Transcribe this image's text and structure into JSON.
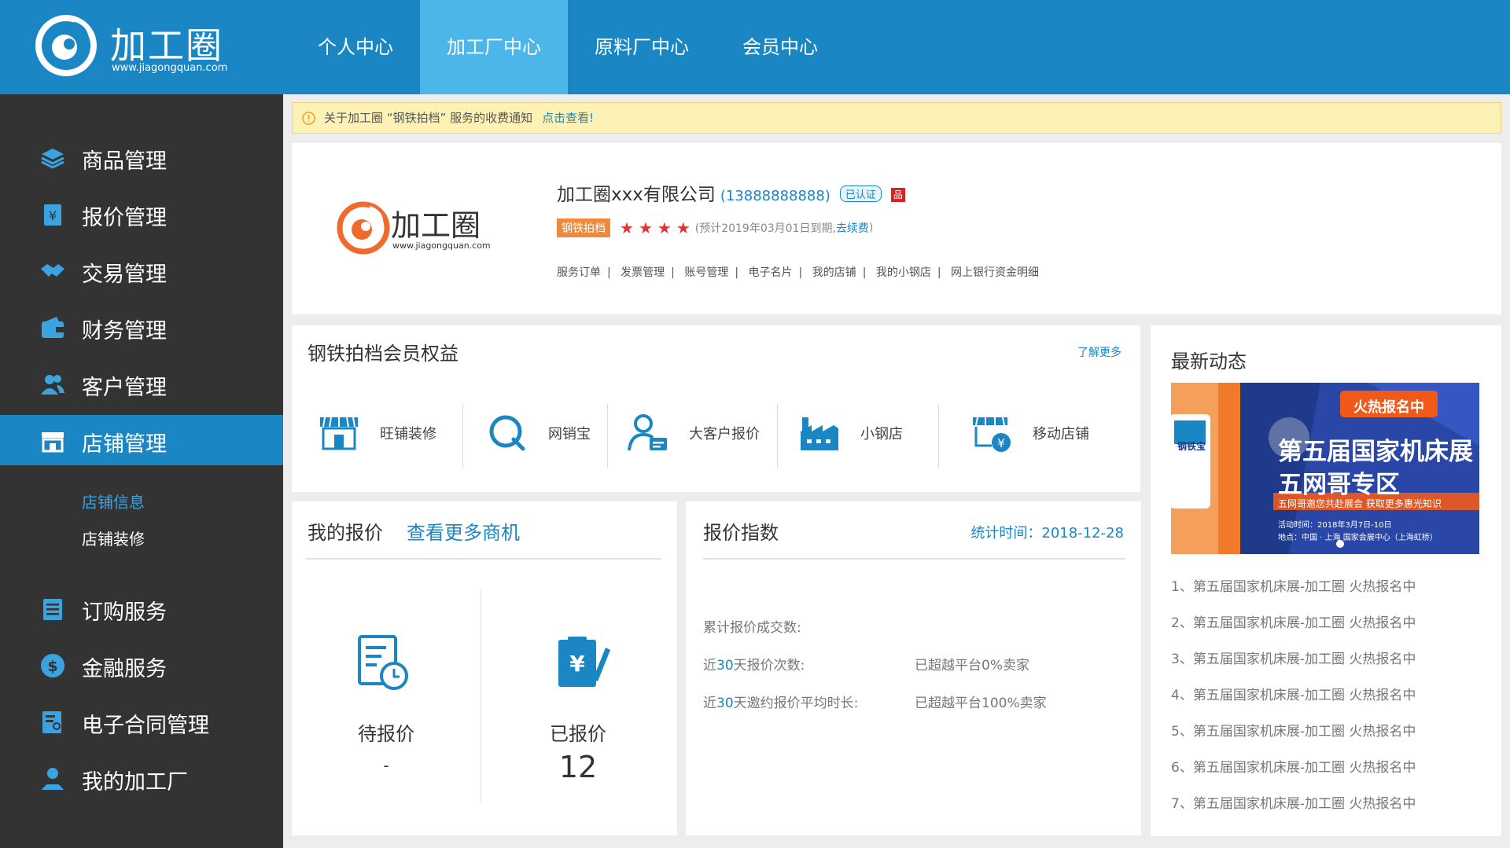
{
  "brand": {
    "name": "加工圈",
    "url": "www.jiagongquan.com",
    "primary_color": "#1a87c4",
    "header_active_color": "#4db6e9",
    "sidebar_color": "#333333"
  },
  "nav": {
    "items": [
      "个人中心",
      "加工厂中心",
      "原料厂中心",
      "会员中心"
    ],
    "active": "加工厂中心"
  },
  "sidebar": {
    "items": [
      {
        "label": "商品管理",
        "icon": "layers-icon"
      },
      {
        "label": "报价管理",
        "icon": "price-tag-icon"
      },
      {
        "label": "交易管理",
        "icon": "handshake-icon"
      },
      {
        "label": "财务管理",
        "icon": "wallet-icon"
      },
      {
        "label": "客户管理",
        "icon": "users-icon"
      },
      {
        "label": "店铺管理",
        "icon": "store-icon"
      },
      {
        "label": "订购服务",
        "icon": "list-icon"
      },
      {
        "label": "金融服务",
        "icon": "dollar-icon"
      },
      {
        "label": "电子合同管理",
        "icon": "contract-icon"
      },
      {
        "label": "我的加工厂",
        "icon": "factory-user-icon"
      }
    ],
    "active": "店铺管理",
    "subitems": [
      {
        "label": "店铺信息",
        "active": true
      },
      {
        "label": "店铺装修",
        "active": false
      }
    ]
  },
  "notice": {
    "text": "关于加工圈 “钢铁拍档” 服务的收费通知",
    "link": "点击查看!",
    "icon": "info-icon"
  },
  "company": {
    "name": "加工圈xxx有限公司",
    "phone": "(13888888888)",
    "verified": "已认证",
    "pin": "品",
    "badge": "钢铁拍档",
    "stars": 4,
    "expiry_prefix": "(预计2019年03月01日到期,",
    "renew": "去续费",
    "expiry_suffix": ")",
    "links": [
      "服务订单",
      "发票管理",
      "账号管理",
      "电子名片",
      "我的店铺",
      "我的小钢店",
      "网上银行资金明细"
    ]
  },
  "benefits": {
    "title": "钢铁拍档会员权益",
    "more": "了解更多",
    "items": [
      {
        "label": "旺铺装修",
        "icon": "shop-icon"
      },
      {
        "label": "网销宝",
        "icon": "search-q-icon"
      },
      {
        "label": "大客户报价",
        "icon": "user-card-icon"
      },
      {
        "label": "小钢店",
        "icon": "factory-icon"
      },
      {
        "label": "移动店铺",
        "icon": "mobile-shop-icon"
      }
    ]
  },
  "quotes": {
    "title": "我的报价",
    "more": "查看更多商机",
    "pending_label": "待报价",
    "pending_value": "-",
    "done_label": "已报价",
    "done_value": "12"
  },
  "index": {
    "title": "报价指数",
    "date": "统计时间：2018-12-28",
    "row1": "累计报价成交数:",
    "row2_prefix": "近",
    "row2_hl": "30",
    "row2_suffix": "天报价次数:",
    "row2_value": "已超越平台0%卖家",
    "row3_prefix": "近",
    "row3_hl": "30",
    "row3_suffix": "天邀约报价平均时长:",
    "row3_value": "已超越平台100%卖家"
  },
  "news": {
    "title": "最新动态",
    "banner": {
      "tag": "火热报名中",
      "line1": "第五届国家机床展",
      "line2": "五网哥专区",
      "line3": "五网哥邀您共赴展会 获取更多惠光知识",
      "line4": "活动时间：2018年3月7日-10日",
      "line5": "地点：中国 · 上海 国家会展中心（上海虹桥）",
      "side": "钢铁宝"
    },
    "items": [
      "1、第五届国家机床展-加工圈 火热报名中",
      "2、第五届国家机床展-加工圈 火热报名中",
      "3、第五届国家机床展-加工圈 火热报名中",
      "4、第五届国家机床展-加工圈 火热报名中",
      "5、第五届国家机床展-加工圈 火热报名中",
      "6、第五届国家机床展-加工圈 火热报名中",
      "7、第五届国家机床展-加工圈 火热报名中"
    ]
  }
}
